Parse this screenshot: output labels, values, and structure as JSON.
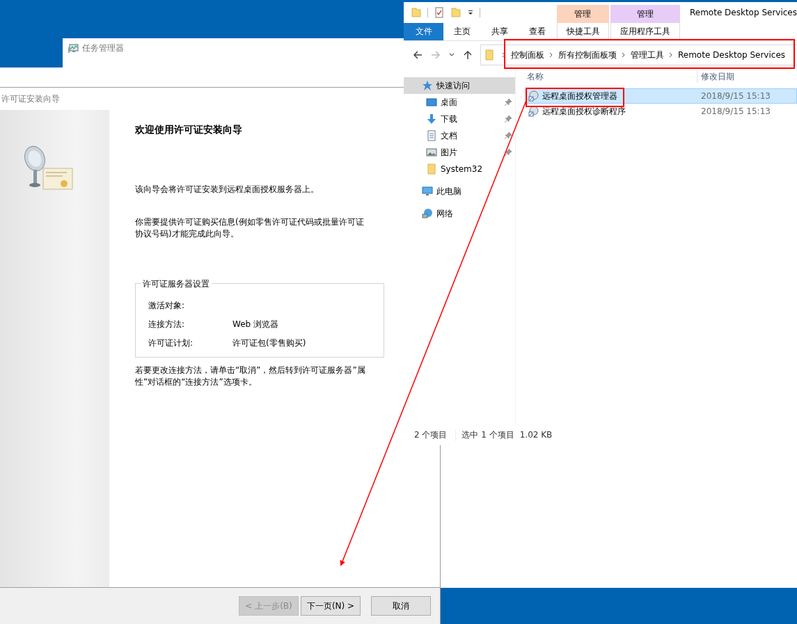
{
  "task_manager": {
    "title": "任务管理器"
  },
  "wizard": {
    "title": "许可证安装向导",
    "heading": "欢迎使用许可证安装向导",
    "paragraphs": [
      "该向导会将许可证安装到远程桌面授权服务器上。",
      "你需要提供许可证购买信息(例如零售许可证代码或批量许可证协议号码)才能完成此向导。"
    ],
    "group": {
      "title": "许可证服务器设置",
      "rows": [
        {
          "label": "激活对象:"
        },
        {
          "label": "连接方法:",
          "value": "Web 浏览器"
        },
        {
          "label": "许可证计划:",
          "value": "许可证包(零售购买)"
        }
      ]
    },
    "note": "若要更改连接方法，请单击“取消”，然后转到许可证服务器”属性”对话框的“连接方法”选项卡。",
    "buttons": [
      {
        "label": "< 上一步(B)",
        "disabled": true
      },
      {
        "label": "下一页(N) >",
        "disabled": false
      },
      {
        "label": "取消",
        "disabled": false
      }
    ]
  },
  "explorer": {
    "title": "Remote Desktop Services",
    "context_tabs": [
      {
        "group": "管理",
        "label": "快捷工具",
        "color": "#fcd3bd"
      },
      {
        "group": "管理",
        "label": "应用程序工具",
        "color": "#e6ccf7"
      }
    ],
    "ribbon_tabs": [
      {
        "label": "文件",
        "kind": "file"
      },
      {
        "label": "主页",
        "kind": "tab"
      },
      {
        "label": "共享",
        "kind": "tab"
      },
      {
        "label": "查看",
        "kind": "tab"
      }
    ],
    "breadcrumb": [
      "控制面板",
      "所有控制面板项",
      "管理工具",
      "Remote Desktop Services"
    ],
    "nav_pane": [
      {
        "label": "快速访问",
        "kind": "star",
        "selected": true,
        "children": [
          {
            "label": "桌面",
            "kind": "desktop",
            "pinned": true,
            "selected": false
          },
          {
            "label": "下载",
            "kind": "download",
            "pinned": true,
            "selected": false
          },
          {
            "label": "文档",
            "kind": "document",
            "pinned": true,
            "selected": false
          },
          {
            "label": "图片",
            "kind": "picture",
            "pinned": true,
            "selected": false
          },
          {
            "label": "System32",
            "kind": "folder",
            "pinned": false,
            "selected": false
          }
        ]
      },
      {
        "label": "此电脑",
        "kind": "computer",
        "selected": false
      },
      {
        "label": "网络",
        "kind": "network",
        "selected": false
      }
    ],
    "columns": [
      "名称",
      "修改日期"
    ],
    "files": [
      {
        "name": "远程桌面授权管理器",
        "modified": "2018/9/15 15:13",
        "selected": true
      },
      {
        "name": "远程桌面授权诊断程序",
        "modified": "2018/9/15 15:13",
        "selected": false
      }
    ],
    "status": [
      "2 个项目",
      "选中 1 个项目",
      "1.02 KB"
    ]
  }
}
